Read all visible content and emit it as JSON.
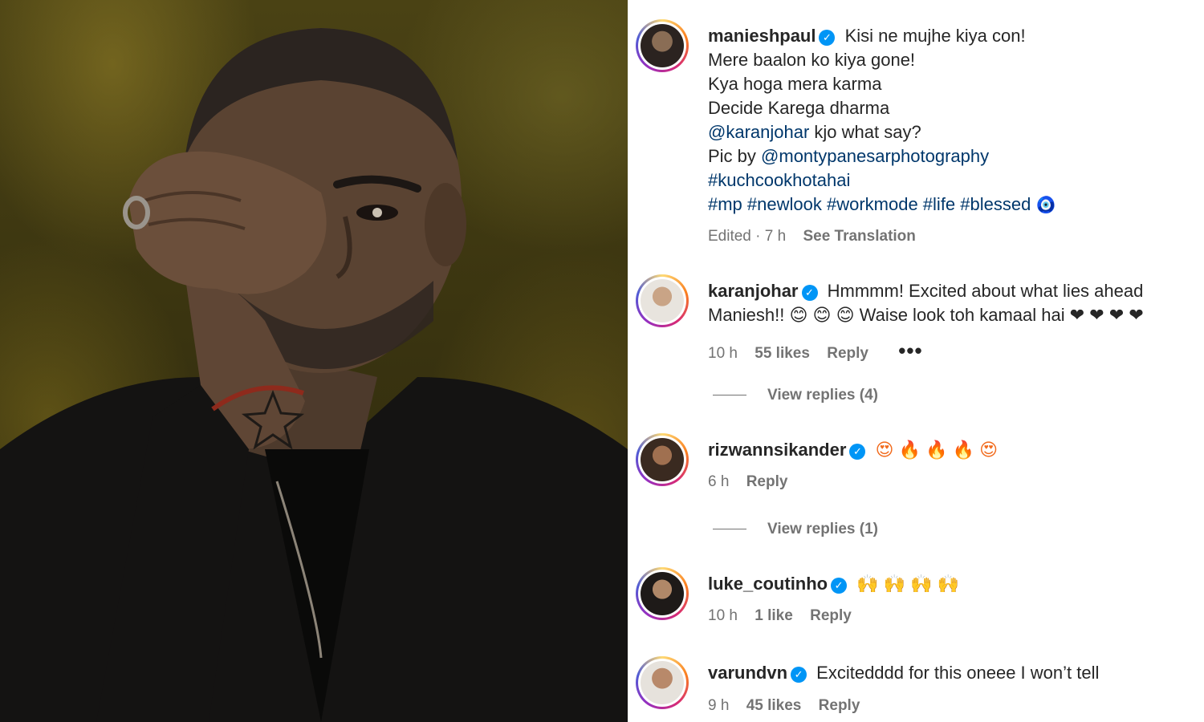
{
  "post": {
    "author": "manieshpaul",
    "caption_lines": [
      "Kisi ne mujhe kiya con!",
      "Mere baalon ko kiya gone!",
      "Kya hoga mera karma",
      "Decide Karega dharma"
    ],
    "mention1": "@karanjohar",
    "mention1_tail": " kjo what say?",
    "picby_prefix": "Pic by ",
    "mention2": "@montypanesarphotography",
    "hashtag_line1": "#kuchcookhotahai",
    "hashtag_line2": "#mp #newlook #workmode #life #blessed",
    "nazar_emoji": "🧿",
    "edited": "Edited · 7 h",
    "see_translation": "See Translation"
  },
  "comments": [
    {
      "user": "karanjohar",
      "text_line1": "Hmmmm! Excited about what lies ahead",
      "text_line2": "Maniesh!! 😊 😊 😊 Waise look toh kamaal hai ❤ ❤ ❤ ❤",
      "time": "10 h",
      "likes": "55 likes",
      "reply": "Reply",
      "more": "•••",
      "view_replies": "View replies (4)"
    },
    {
      "user": "rizwannsikander",
      "text_line1": "😍 🔥 🔥 🔥 😍",
      "time": "6 h",
      "reply": "Reply",
      "view_replies": "View replies (1)"
    },
    {
      "user": "luke_coutinho",
      "text_line1": "🙌 🙌 🙌 🙌",
      "time": "10 h",
      "likes": "1 like",
      "reply": "Reply"
    },
    {
      "user": "varundvn",
      "text_line1": "Excitedddd for this oneee I won’t tell",
      "time": "9 h",
      "likes": "45 likes",
      "reply": "Reply"
    }
  ],
  "icons": {
    "verified": "verified-badge-icon",
    "verified_glyph": "✓"
  },
  "colors": {
    "verified": "#0095f6",
    "link": "#00376b",
    "muted": "#737373"
  }
}
